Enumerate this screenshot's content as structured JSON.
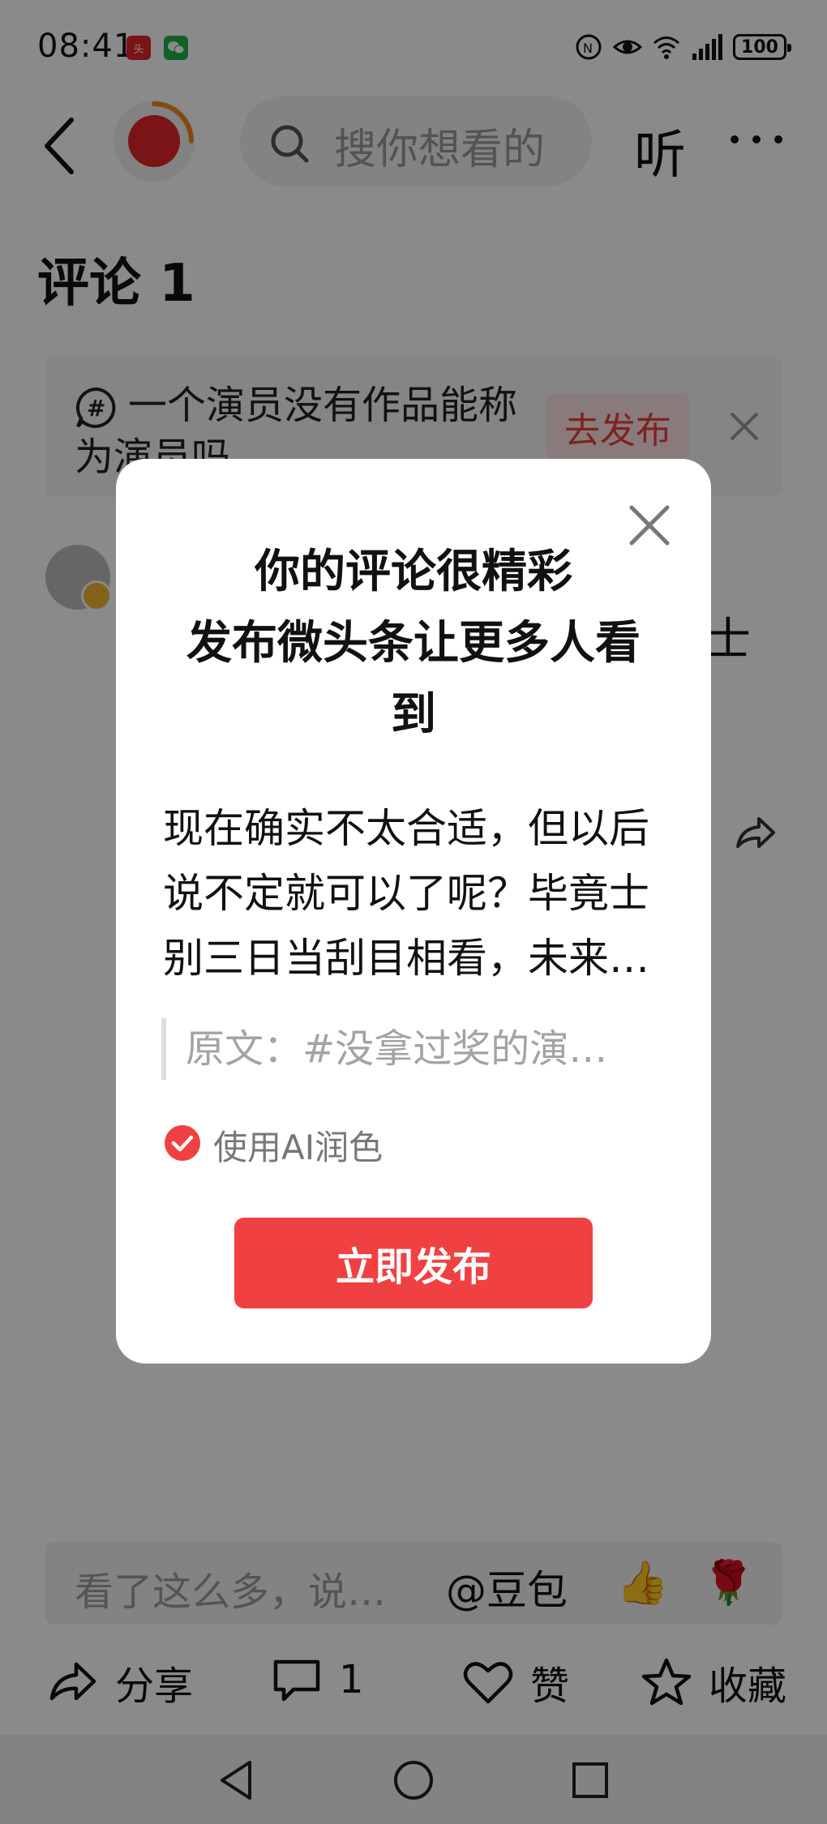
{
  "status_bar": {
    "time": "08:41",
    "app_icons": [
      "toutiao-notification-icon",
      "wechat-notification-icon"
    ],
    "battery": "100"
  },
  "top_nav": {
    "search_placeholder": "搜你想看的",
    "listen_label": "听"
  },
  "comments": {
    "title": "评论 1",
    "topic_text": "一个演员没有作品能称为演员吗",
    "topic_action": "去发布",
    "partial_char": "士"
  },
  "bottom_bar": {
    "input_placeholder": "看了这么多，说…",
    "at_label": "@豆包",
    "share_label": "分享",
    "comment_count": "1",
    "like_label": "赞",
    "favorite_label": "收藏"
  },
  "modal": {
    "title_line1": "你的评论很精彩",
    "title_line2": "发布微头条让更多人看到",
    "body": "现在确实不太合适，但以后说不定就可以了呢？毕竟士别三日当刮目相看，未来…",
    "original_quote": "原文：#没拿过奖的演…",
    "ai_polish_label": "使用AI润色",
    "ai_polish_checked": true,
    "publish_button": "立即发布"
  },
  "colors": {
    "accent_red": "#f04142",
    "topic_action_bg": "#fde4e3",
    "overlay": "rgba(0,0,0,0.46)"
  }
}
